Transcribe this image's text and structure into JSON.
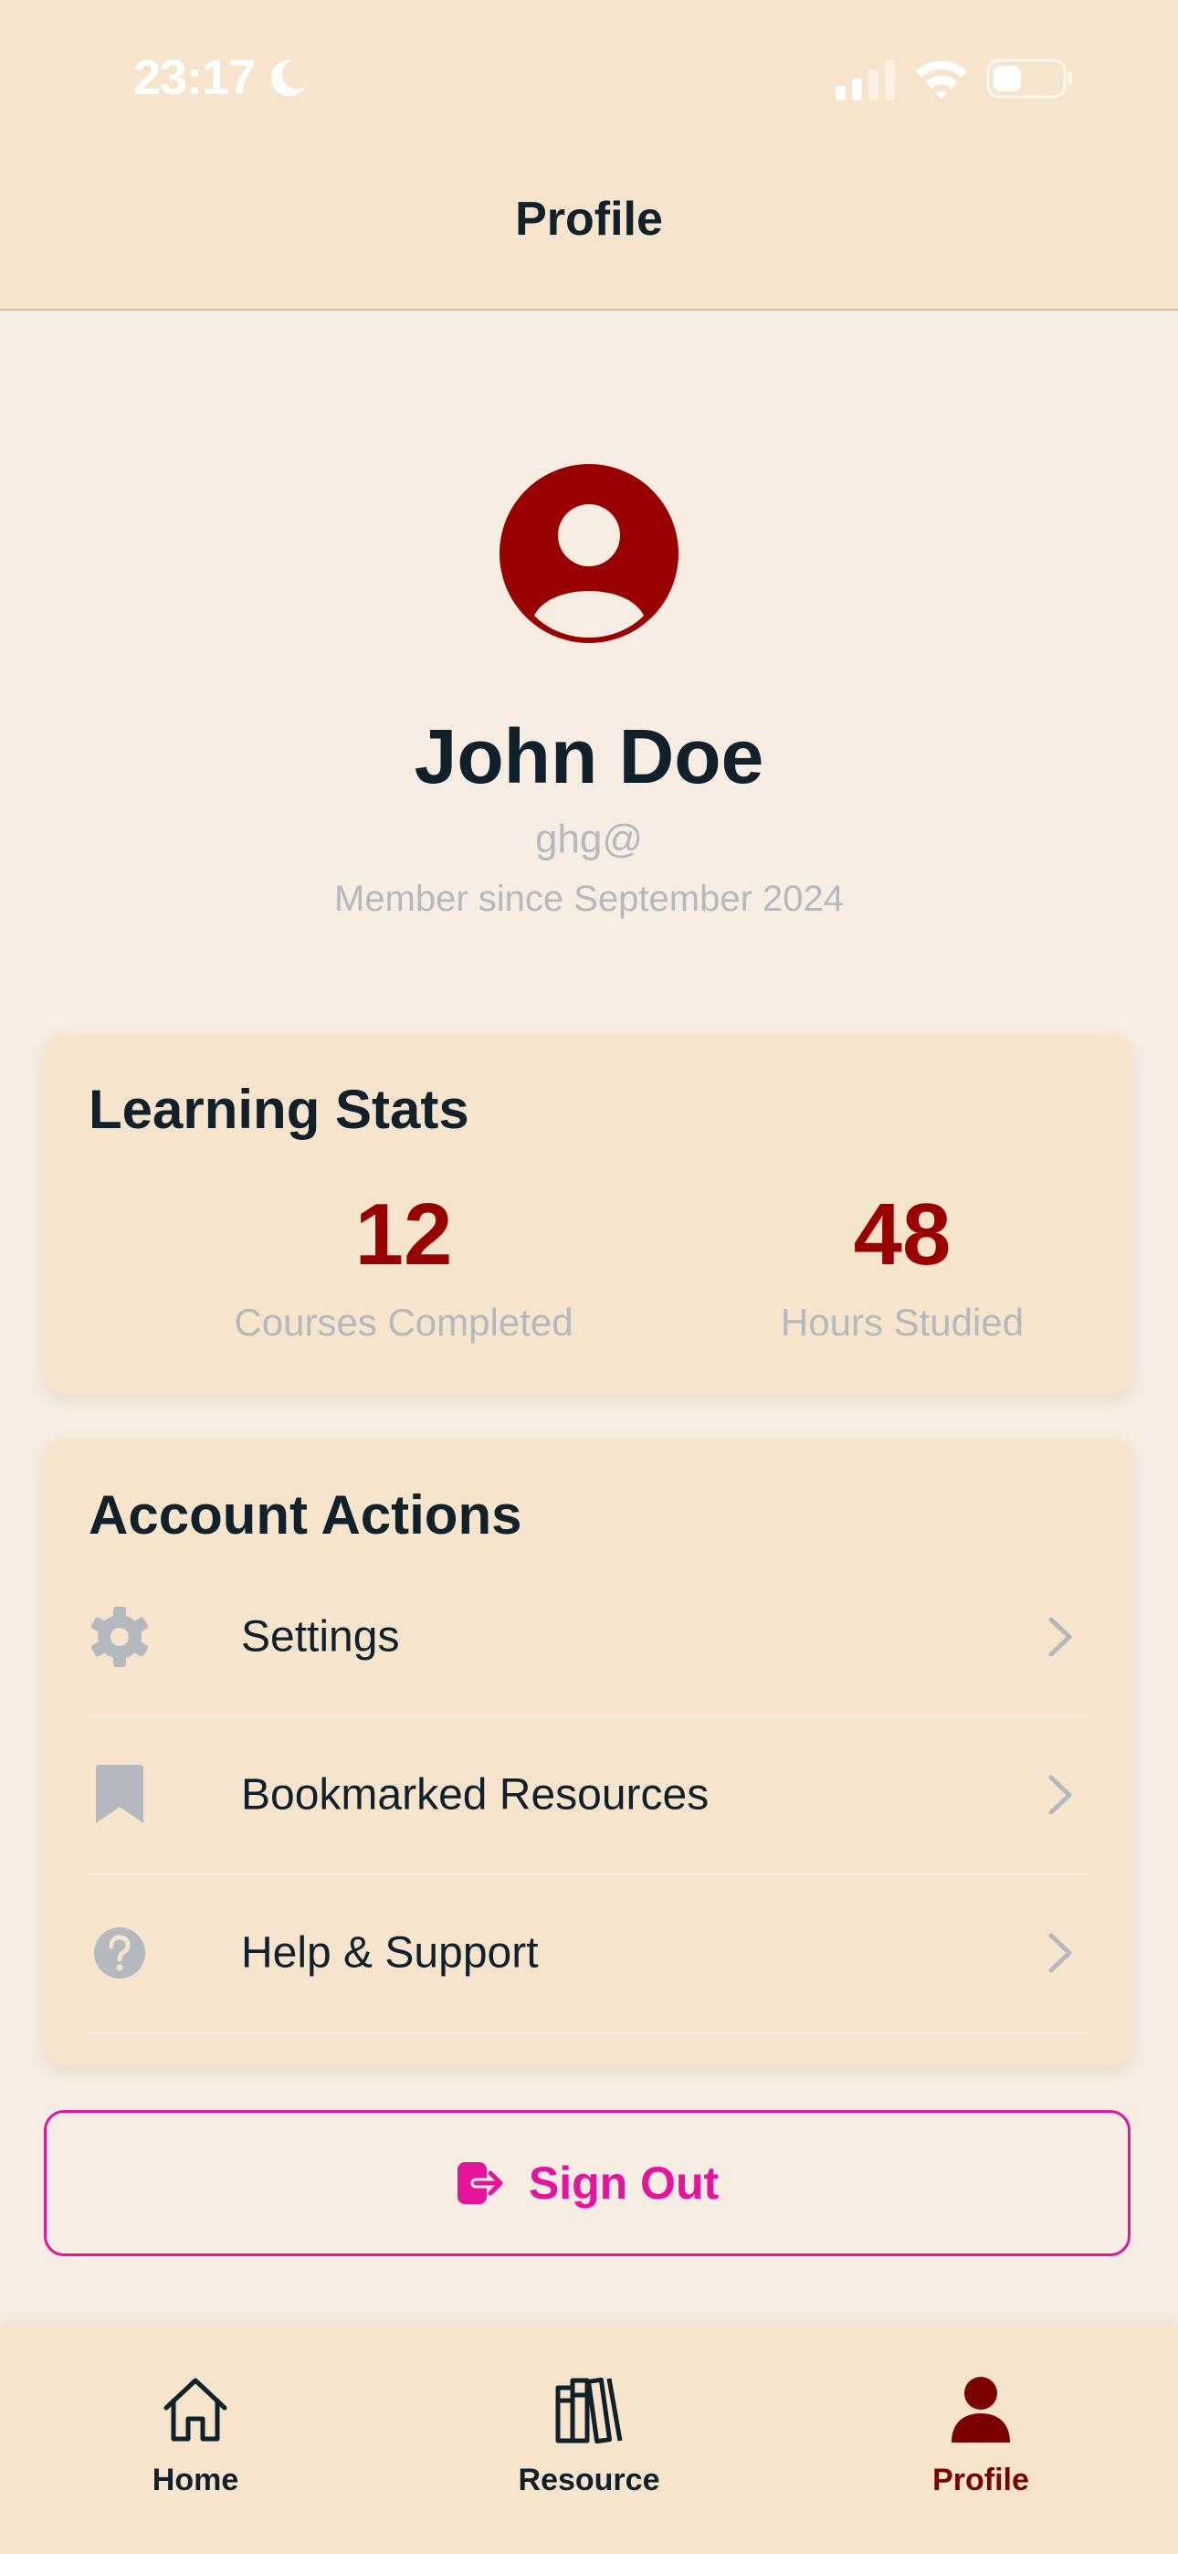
{
  "status_bar": {
    "time": "23:17"
  },
  "header": {
    "title": "Profile"
  },
  "profile": {
    "name": "John Doe",
    "email": "ghg@",
    "member_since": "Member since September 2024"
  },
  "stats": {
    "title": "Learning Stats",
    "items": [
      {
        "value": "12",
        "label": "Courses Completed"
      },
      {
        "value": "48",
        "label": "Hours Studied"
      }
    ]
  },
  "actions": {
    "title": "Account Actions",
    "items": [
      {
        "label": "Settings",
        "icon": "gear-icon"
      },
      {
        "label": "Bookmarked Resources",
        "icon": "bookmark-icon"
      },
      {
        "label": "Help & Support",
        "icon": "question-circle-icon"
      }
    ]
  },
  "sign_out": {
    "label": "Sign Out",
    "icon": "sign-out-icon"
  },
  "tabbar": {
    "active": "Profile",
    "items": [
      {
        "label": "Home",
        "icon": "home-icon"
      },
      {
        "label": "Resource",
        "icon": "books-icon"
      },
      {
        "label": "Profile",
        "icon": "person-icon"
      }
    ]
  },
  "colors": {
    "accent": "#990000",
    "signout": "#e5149c",
    "header_bg": "#f6e4cd",
    "page_bg": "#f8ede2",
    "muted_text": "#b4b9bf",
    "dark_text": "#10212c"
  }
}
